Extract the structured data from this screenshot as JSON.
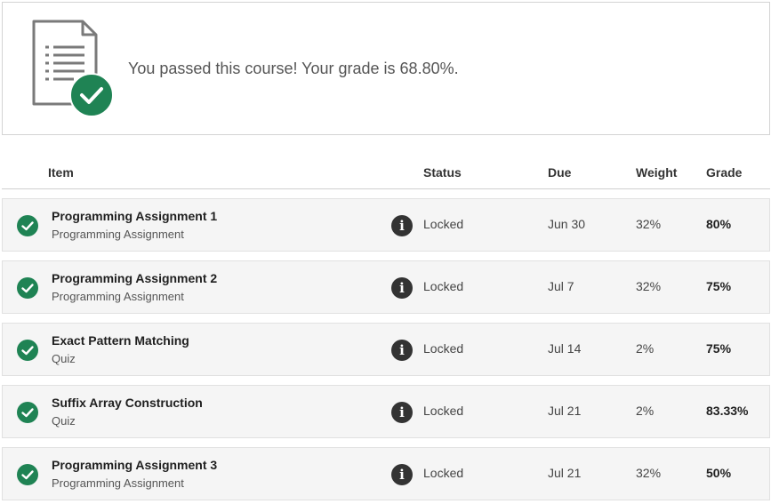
{
  "banner": {
    "icon": "document-checkmark-icon",
    "message": "You passed this course! Your grade is 68.80%."
  },
  "table": {
    "headers": {
      "item": "Item",
      "status": "Status",
      "due": "Due",
      "weight": "Weight",
      "grade": "Grade"
    },
    "rows": [
      {
        "title": "Programming Assignment 1",
        "type": "Programming Assignment",
        "status": "Locked",
        "due": "Jun 30",
        "weight": "32%",
        "grade": "80%"
      },
      {
        "title": "Programming Assignment 2",
        "type": "Programming Assignment",
        "status": "Locked",
        "due": "Jul 7",
        "weight": "32%",
        "grade": "75%"
      },
      {
        "title": "Exact Pattern Matching",
        "type": "Quiz",
        "status": "Locked",
        "due": "Jul 14",
        "weight": "2%",
        "grade": "75%"
      },
      {
        "title": "Suffix Array Construction",
        "type": "Quiz",
        "status": "Locked",
        "due": "Jul 21",
        "weight": "2%",
        "grade": "83.33%"
      },
      {
        "title": "Programming Assignment 3",
        "type": "Programming Assignment",
        "status": "Locked",
        "due": "Jul 21",
        "weight": "32%",
        "grade": "50%"
      }
    ]
  },
  "icons": {
    "row_status": "check-circle-icon",
    "status_info": "info-icon"
  },
  "colors": {
    "success_green": "#1f8354",
    "info_dark": "#333333",
    "row_background": "#f5f5f5"
  }
}
